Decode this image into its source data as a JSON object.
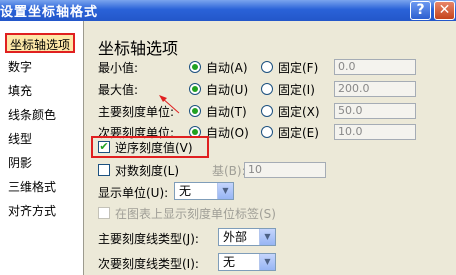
{
  "window": {
    "title": "设置坐标轴格式",
    "help": "?",
    "close": "✕"
  },
  "sidebar": {
    "items": [
      "坐标轴选项",
      "数字",
      "填充",
      "线条颜色",
      "线型",
      "阴影",
      "三维格式",
      "对齐方式"
    ]
  },
  "main": {
    "heading": "坐标轴选项",
    "rows": [
      {
        "label": "最小值:",
        "auto": "自动(A)",
        "fixed": "固定(F)",
        "value": "0.0"
      },
      {
        "label": "最大值:",
        "auto": "自动(U)",
        "fixed": "固定(I)",
        "value": "200.0"
      },
      {
        "label": "主要刻度单位:",
        "auto": "自动(T)",
        "fixed": "固定(X)",
        "value": "50.0"
      },
      {
        "label": "次要刻度单位:",
        "auto": "自动(O)",
        "fixed": "固定(E)",
        "value": "10.0"
      }
    ],
    "reverse_label": "逆序刻度值(V)",
    "log_label": "对数刻度(L)",
    "base_label": "基(B):",
    "base_value": "10",
    "display_unit_label": "显示单位(U):",
    "display_unit_value": "无",
    "show_unit_label": "在图表上显示刻度单位标签(S)",
    "major_tick_label": "主要刻度线类型(J):",
    "major_tick_value": "外部",
    "minor_tick_label": "次要刻度线类型(I):",
    "minor_tick_value": "无"
  }
}
